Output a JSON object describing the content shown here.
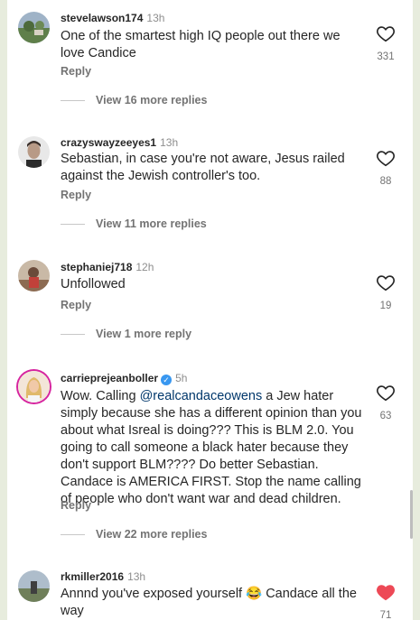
{
  "comments": [
    {
      "username": "stevelawson174",
      "time": "13h",
      "text": "One of the smartest high IQ people out there we love Candice",
      "reply_label": "Reply",
      "likes": "331",
      "liked": false,
      "view_replies": "View 16 more replies"
    },
    {
      "username": "crazyswayzeeyes1",
      "time": "13h",
      "text": "Sebastian, in case you're not aware, Jesus railed against the Jewish controller's too.",
      "reply_label": "Reply",
      "likes": "88",
      "liked": false,
      "view_replies": "View 11 more replies"
    },
    {
      "username": "stephaniej718",
      "time": "12h",
      "text": "Unfollowed",
      "reply_label": "Reply",
      "likes": "19",
      "liked": false,
      "view_replies": "View 1 more reply"
    },
    {
      "username": "carrieprejeanboller",
      "time": "5h",
      "verified": true,
      "text_prefix": "Wow. Calling ",
      "mention": "@realcandaceowens",
      "text_suffix": " a Jew hater simply because she has a different opinion than you about what Isreal is doing??? This is BLM 2.0. You going to call someone a black hater because they don't support BLM???? Do better Sebastian. Candace is AMERICA FIRST. Stop the name calling of people who don't want war and dead children.",
      "reply_label": "Reply",
      "likes": "63",
      "liked": false,
      "view_replies": "View 22 more replies"
    },
    {
      "username": "rkmiller2016",
      "time": "13h",
      "text_prefix": "Annnd you've exposed yourself ",
      "emoji": "😂",
      "text_suffix": " Candace all the way",
      "likes": "71",
      "liked": true
    }
  ],
  "colors": {
    "like_red": "#ed4956",
    "mention_blue": "#00376b",
    "verified_blue": "#3897f0"
  },
  "icons": {
    "like": "heart-outline-icon",
    "liked": "heart-filled-icon"
  }
}
